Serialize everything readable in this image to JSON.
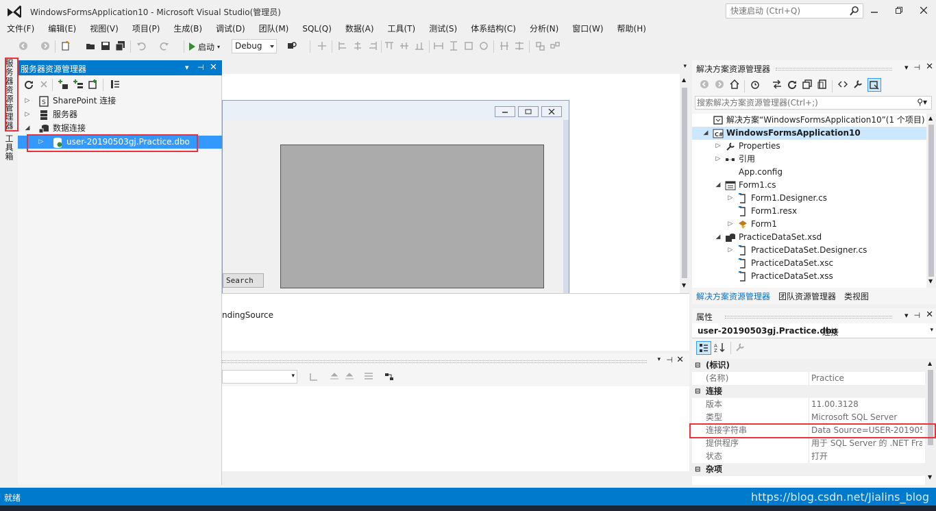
{
  "window": {
    "title": "WindowsFormsApplication10 - Microsoft Visual Studio(管理员)",
    "quick_launch_placeholder": "快速启动 (Ctrl+Q)"
  },
  "menu": [
    "文件(F)",
    "编辑(E)",
    "视图(V)",
    "项目(P)",
    "生成(B)",
    "调试(D)",
    "团队(M)",
    "SQL(Q)",
    "数据(A)",
    "工具(T)",
    "测试(S)",
    "体系结构(C)",
    "分析(N)",
    "窗口(W)",
    "帮助(H)"
  ],
  "toolbar": {
    "start_label": "启动",
    "config_value": "Debug"
  },
  "left_tabs": {
    "server_explorer": "服务器资源管理器",
    "toolbox": "工具箱"
  },
  "server_explorer": {
    "title": "服务器资源管理器",
    "tree": [
      {
        "label": "SharePoint 连接",
        "level": 0,
        "expanded": false
      },
      {
        "label": "服务器",
        "level": 0,
        "expanded": false
      },
      {
        "label": "数据连接",
        "level": 0,
        "expanded": true
      },
      {
        "label": "user-20190503gj.Practice.dbo",
        "level": 1,
        "expanded": false,
        "selected": true
      }
    ]
  },
  "designer": {
    "search_button": "Search",
    "tray_item": "ndingSource"
  },
  "solution_explorer": {
    "title": "解决方案资源管理器",
    "search_placeholder": "搜索解决方案资源管理器(Ctrl+;)",
    "tree": [
      {
        "label": "解决方案“WindowsFormsApplication10”(1 个项目)",
        "level": 0,
        "arrow": "",
        "icon": "solution-icon"
      },
      {
        "label": "WindowsFormsApplication10",
        "level": 0,
        "arrow": "expanded",
        "icon": "csharp-project-icon",
        "selected": true
      },
      {
        "label": "Properties",
        "level": 1,
        "arrow": "collapsed",
        "icon": "wrench-icon"
      },
      {
        "label": "引用",
        "level": 1,
        "arrow": "collapsed",
        "icon": "references-icon"
      },
      {
        "label": "App.config",
        "level": 1,
        "arrow": "",
        "icon": "config-file-icon"
      },
      {
        "label": "Form1.cs",
        "level": 1,
        "arrow": "expanded",
        "icon": "form-icon"
      },
      {
        "label": "Form1.Designer.cs",
        "level": 2,
        "arrow": "collapsed",
        "icon": "cs-file-icon"
      },
      {
        "label": "Form1.resx",
        "level": 2,
        "arrow": "",
        "icon": "resx-file-icon"
      },
      {
        "label": "Form1",
        "level": 2,
        "arrow": "collapsed",
        "icon": "class-icon"
      },
      {
        "label": "PracticeDataSet.xsd",
        "level": 1,
        "arrow": "expanded",
        "icon": "dataset-icon"
      },
      {
        "label": "PracticeDataSet.Designer.cs",
        "level": 2,
        "arrow": "collapsed",
        "icon": "cs-file-icon"
      },
      {
        "label": "PracticeDataSet.xsc",
        "level": 2,
        "arrow": "",
        "icon": "xml-file-icon"
      },
      {
        "label": "PracticeDataSet.xss",
        "level": 2,
        "arrow": "",
        "icon": "xml-file-icon"
      }
    ],
    "tabs": [
      "解决方案资源管理器",
      "团队资源管理器",
      "类视图"
    ]
  },
  "properties": {
    "title": "属性",
    "object_name": "user-20190503gj.Practice.dbo",
    "object_type": "连接",
    "rows": [
      {
        "kind": "cat",
        "name": "(标识)"
      },
      {
        "kind": "prop",
        "name": "(名称)",
        "value": "Practice"
      },
      {
        "kind": "cat",
        "name": "连接"
      },
      {
        "kind": "prop",
        "name": "版本",
        "value": "11.00.3128"
      },
      {
        "kind": "prop",
        "name": "类型",
        "value": "Microsoft SQL Server"
      },
      {
        "kind": "prop",
        "name": "连接字符串",
        "value": "Data Source=USER-201905"
      },
      {
        "kind": "prop",
        "name": "提供程序",
        "value": "用于 SQL Server 的 .NET Fra"
      },
      {
        "kind": "prop",
        "name": "状态",
        "value": "打开"
      },
      {
        "kind": "cat",
        "name": "杂项"
      }
    ]
  },
  "status": {
    "text": "就绪",
    "watermark": "https://blog.csdn.net/Jialins_blog"
  },
  "colors": {
    "accent": "#007acc",
    "highlight_box": "#e8323c",
    "selection": "#3399ff"
  }
}
